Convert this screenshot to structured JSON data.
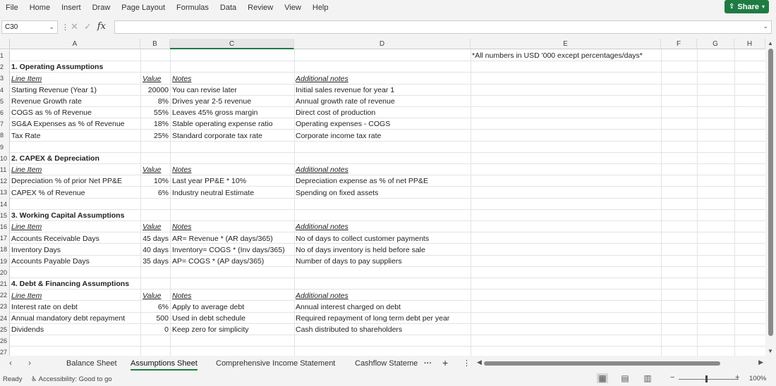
{
  "menu": [
    "File",
    "Home",
    "Insert",
    "Draw",
    "Page Layout",
    "Formulas",
    "Data",
    "Review",
    "View",
    "Help"
  ],
  "share": {
    "label": "Share"
  },
  "formula_bar": {
    "name_box": "C30",
    "fx": "fx",
    "content": ""
  },
  "columns": [
    "A",
    "B",
    "C",
    "D",
    "E",
    "F",
    "G",
    "H"
  ],
  "rows": [
    "1",
    "2",
    "3",
    "4",
    "5",
    "6",
    "7",
    "8",
    "9",
    "10",
    "11",
    "12",
    "13",
    "14",
    "15",
    "16",
    "17",
    "18",
    "19",
    "20",
    "21",
    "22",
    "23",
    "24",
    "25",
    "26",
    "27"
  ],
  "note": "*All numbers in USD '000 except percentages/days*",
  "sections": {
    "s1": {
      "title": "1. Operating Assumptions",
      "headers": {
        "item": "Line Item",
        "value": "Value",
        "notes": "Notes",
        "additional": "Additional notes"
      },
      "rows": [
        {
          "item": "Starting Revenue (Year 1)",
          "value": "20000",
          "notes": "You can revise later",
          "additional": "Initial sales revenue for year 1"
        },
        {
          "item": "Revenue Growth rate",
          "value": "8%",
          "notes": "Drives year 2-5 revenue",
          "additional": "Annual growth rate of revenue"
        },
        {
          "item": "COGS as % of Revenue",
          "value": "55%",
          "notes": "Leaves 45% gross margin",
          "additional": "Direct cost of production"
        },
        {
          "item": "SG&A Expenses as % of Revenue",
          "value": "18%",
          "notes": "Stable operating expense ratio",
          "additional": "Operating expenses - COGS"
        },
        {
          "item": "Tax Rate",
          "value": "25%",
          "notes": "Standard corporate tax rate",
          "additional": "Corporate income tax rate"
        }
      ]
    },
    "s2": {
      "title": "2. CAPEX & Depreciation",
      "headers": {
        "item": "Line Item",
        "value": "Value",
        "notes": "Notes",
        "additional": "Additional notes"
      },
      "rows": [
        {
          "item": "Depreciation % of prior Net PP&E",
          "value": "10%",
          "notes": "Last year PP&E * 10%",
          "additional": "Depreciation expense as % of net PP&E"
        },
        {
          "item": "CAPEX % of Revenue",
          "value": "6%",
          "notes": "Industry neutral Estimate",
          "additional": "Spending on fixed assets"
        }
      ]
    },
    "s3": {
      "title": "3. Working Capital Assumptions",
      "headers": {
        "item": "Line Item",
        "value": "Value",
        "notes": "Notes",
        "additional": "Additional notes"
      },
      "rows": [
        {
          "item": "Accounts Receivable Days",
          "value": "45 days",
          "notes": "AR= Revenue * (AR days/365)",
          "additional": "No of days to collect customer payments"
        },
        {
          "item": "Inventory Days",
          "value": "40 days",
          "notes": "Inventory= COGS * (Inv days/365)",
          "additional": "No of days inventory is held before sale"
        },
        {
          "item": "Accounts Payable Days",
          "value": "35 days",
          "notes": "AP= COGS * (AP days/365)",
          "additional": "Number of days to pay suppliers"
        }
      ]
    },
    "s4": {
      "title": "4. Debt & Financing Assumptions",
      "headers": {
        "item": "Line Item",
        "value": "Value",
        "notes": "Notes",
        "additional": "Additional notes"
      },
      "rows": [
        {
          "item": "Interest rate on debt",
          "value": "6%",
          "notes": "Apply to average debt",
          "additional": "Annual interest charged on debt"
        },
        {
          "item": "Annual mandatory debt repayment",
          "value": "500",
          "notes": "Used in debt schedule",
          "additional": "Required repayment of long term debt per year"
        },
        {
          "item": "Dividends",
          "value": "0",
          "notes": "Keep zero for simplicity",
          "additional": "Cash distributed to shareholders"
        }
      ]
    }
  },
  "sheet_tabs": [
    "Balance Sheet",
    "Assumptions Sheet",
    "Comprehensive Income Statement",
    "Cashflow Stateme"
  ],
  "active_tab": "Assumptions Sheet",
  "tab_more": "···",
  "tab_add": "+",
  "status": {
    "ready": "Ready",
    "accessibility": "Accessibility: Good to go",
    "zoom": "100%"
  }
}
